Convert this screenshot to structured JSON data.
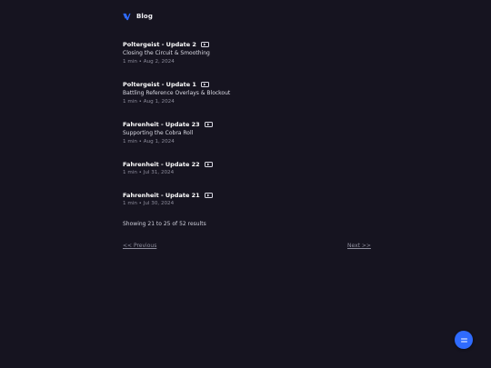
{
  "header": {
    "logo_icon": "blog-logo-icon",
    "brand": "Blog",
    "accent_color": "#2f6bff"
  },
  "posts": [
    {
      "title": "Poltergeist - Update 2",
      "subtitle": "Closing the Circuit & Smoothing",
      "meta": "1 min • Aug 2, 2024",
      "icon": "video-icon"
    },
    {
      "title": "Poltergeist - Update 1",
      "subtitle": "Battling Reference Overlays & Blockout",
      "meta": "1 min • Aug 1, 2024",
      "icon": "video-icon"
    },
    {
      "title": "Fahrenheit - Update 23",
      "subtitle": "Supporting the Cobra Roll",
      "meta": "1 min • Aug 1, 2024",
      "icon": "video-icon"
    },
    {
      "title": "Fahrenheit - Update 22",
      "subtitle": "",
      "meta": "1 min • Jul 31, 2024",
      "icon": "video-icon"
    },
    {
      "title": "Fahrenheit - Update 21",
      "subtitle": "",
      "meta": "1 min • Jul 30, 2024",
      "icon": "video-icon"
    }
  ],
  "pagination": {
    "summary": "Showing 21 to 25 of 52 results",
    "prev_label": "<< Previous",
    "next_label": "Next >>"
  },
  "fab": {
    "icon": "menu-lines-icon",
    "color": "#2f6bff"
  }
}
